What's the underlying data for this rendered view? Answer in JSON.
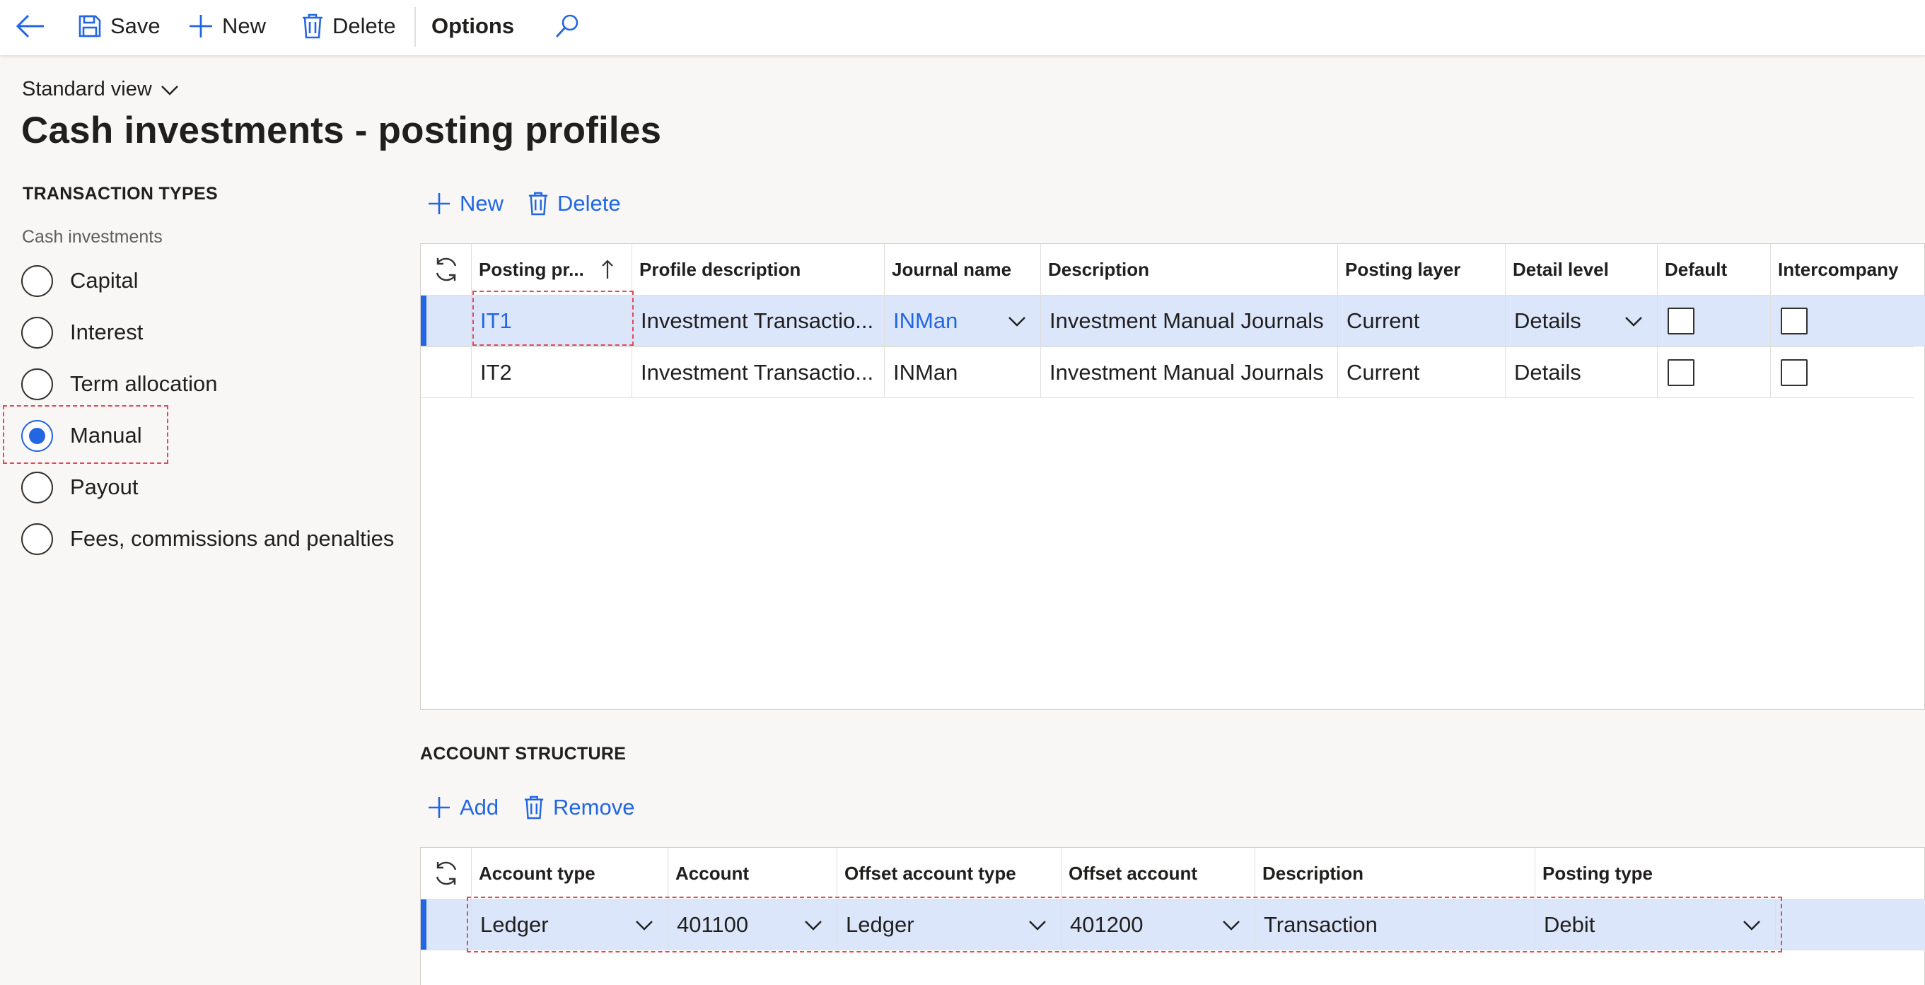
{
  "toolbar": {
    "save_label": "Save",
    "new_label": "New",
    "delete_label": "Delete",
    "options_label": "Options"
  },
  "header": {
    "view_selector": "Standard view",
    "title": "Cash investments - posting profiles"
  },
  "transaction_types": {
    "heading": "TRANSACTION TYPES",
    "subheading": "Cash investments",
    "options": [
      {
        "label": "Capital",
        "selected": false
      },
      {
        "label": "Interest",
        "selected": false
      },
      {
        "label": "Term allocation",
        "selected": false
      },
      {
        "label": "Manual",
        "selected": true
      },
      {
        "label": "Payout",
        "selected": false
      },
      {
        "label": "Fees, commissions and penalties",
        "selected": false
      }
    ]
  },
  "profiles": {
    "new_label": "New",
    "delete_label": "Delete",
    "columns": [
      "Posting pr...",
      "Profile description",
      "Journal name",
      "Description",
      "Posting layer",
      "Detail level",
      "Default",
      "Intercompany"
    ],
    "rows": [
      {
        "posting_profile": "IT1",
        "profile_description": "Investment Transactio...",
        "journal_name": "INMan",
        "description": "Investment Manual Journals",
        "posting_layer": "Current",
        "detail_level": "Details",
        "default": false,
        "intercompany": false,
        "selected": true
      },
      {
        "posting_profile": "IT2",
        "profile_description": "Investment Transactio...",
        "journal_name": "INMan",
        "description": "Investment Manual Journals",
        "posting_layer": "Current",
        "detail_level": "Details",
        "default": false,
        "intercompany": false,
        "selected": false
      }
    ]
  },
  "account_structure": {
    "heading": "ACCOUNT STRUCTURE",
    "add_label": "Add",
    "remove_label": "Remove",
    "columns": [
      "Account type",
      "Account",
      "Offset account type",
      "Offset account",
      "Description",
      "Posting type"
    ],
    "rows": [
      {
        "account_type": "Ledger",
        "account": "401100",
        "offset_account_type": "Ledger",
        "offset_account": "401200",
        "description": "Transaction",
        "posting_type": "Debit",
        "selected": true
      }
    ]
  },
  "colors": {
    "accent": "#2266e3",
    "selected_row": "#dbe6fb",
    "highlight_box": "#e04a57"
  }
}
